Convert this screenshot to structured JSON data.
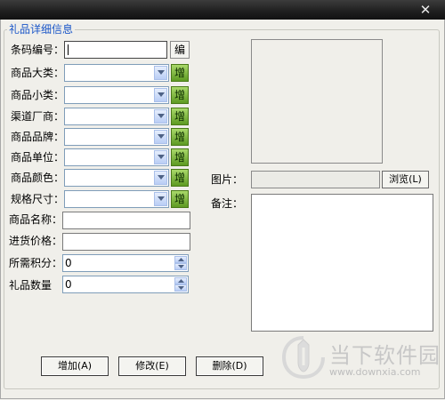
{
  "window": {
    "close_glyph": "✕"
  },
  "group": {
    "title": "礼品详细信息"
  },
  "form": {
    "barcode": {
      "label": "条码编号：",
      "value": "",
      "edit_label": "编"
    },
    "combos": [
      {
        "label": "商品大类：",
        "value": ""
      },
      {
        "label": "商品小类：",
        "value": ""
      },
      {
        "label": "渠道厂商：",
        "value": ""
      },
      {
        "label": "商品品牌：",
        "value": ""
      },
      {
        "label": "商品单位：",
        "value": ""
      },
      {
        "label": "商品颜色：",
        "value": ""
      },
      {
        "label": "规格尺寸：",
        "value": ""
      }
    ],
    "add_label": "增",
    "name": {
      "label": "商品名称：",
      "value": ""
    },
    "price": {
      "label": "进货价格：",
      "value": ""
    },
    "points": {
      "label": "所需积分：",
      "value": "0"
    },
    "quantity": {
      "label": "礼品数量",
      "value": "0"
    }
  },
  "image": {
    "label": "图片：",
    "path": "",
    "browse_label": "浏览(L)"
  },
  "remarks": {
    "label": "备注：",
    "value": ""
  },
  "buttons": {
    "add": "增加(A)",
    "modify": "修改(E)",
    "delete": "删除(D)"
  },
  "watermark": {
    "text": "当下软件园",
    "url": "www.downxia.com"
  },
  "colors": {
    "title": "#1a56c8",
    "add_button": "#7cb83a",
    "titlebar": "#1e1e1e"
  }
}
